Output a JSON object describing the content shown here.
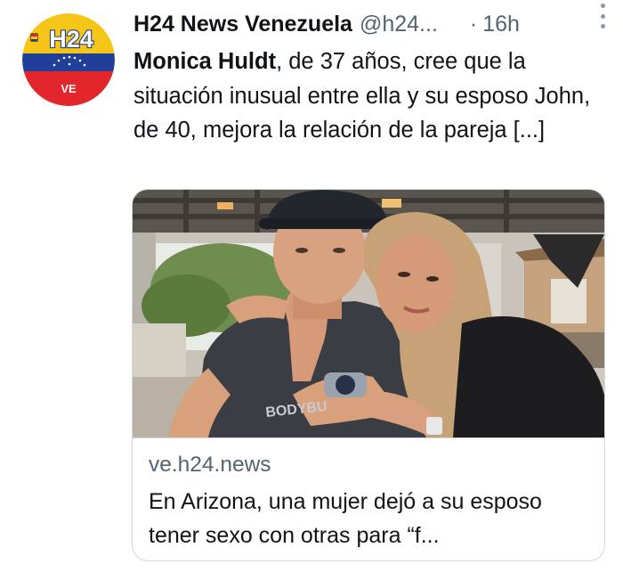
{
  "colors": {
    "text_primary": "#0f1419",
    "text_secondary": "#536471",
    "border": "#cfd9de",
    "flag_yellow": "#f5c518",
    "flag_blue": "#1f3f99",
    "flag_red": "#e3262c"
  },
  "avatar": {
    "logo_text": "H24",
    "country_code": "VE"
  },
  "header": {
    "author_name": "H24 News Venezuela",
    "handle": "@h24...",
    "separator": "·",
    "time": "16h",
    "more_icon": "more-vertical-icon"
  },
  "tweet": {
    "bold_name": "Monica Huldt",
    "text": ", de 37 años, cree que la situación inusual entre ella y su esposo John, de 40, mejora la relación de la pareja [...]"
  },
  "card": {
    "image_shirt_text": "BODYBU",
    "domain": "ve.h24.news",
    "title": "En Arizona, una mujer dejó a su esposo tener sexo con otras para “f..."
  }
}
